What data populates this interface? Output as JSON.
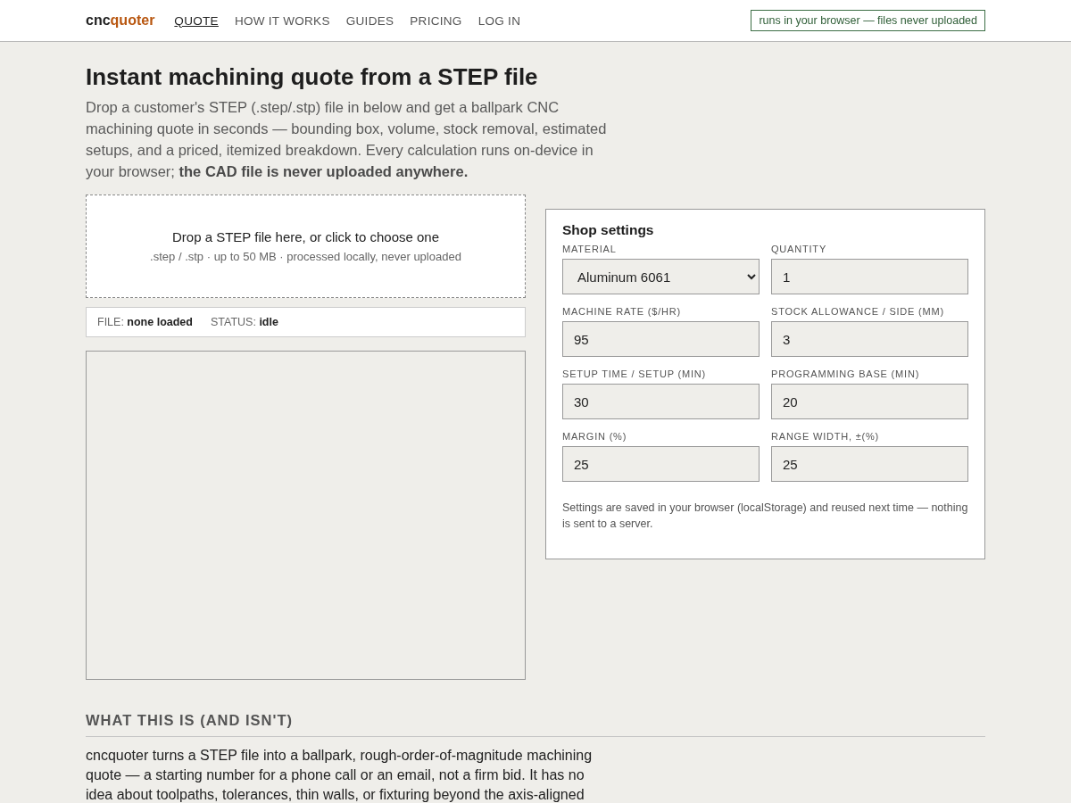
{
  "header": {
    "logo": {
      "prefix": "cnc",
      "accent": "quoter"
    },
    "nav": [
      {
        "label": "QUOTE",
        "selected": true
      },
      {
        "label": "HOW IT WORKS",
        "selected": false
      },
      {
        "label": "GUIDES",
        "selected": false
      },
      {
        "label": "PRICING",
        "selected": false
      },
      {
        "label": "LOG IN",
        "selected": false
      }
    ],
    "badge": "runs in your browser — files never uploaded"
  },
  "title": "Instant machining quote from a STEP file",
  "intro": "Drop a customer's STEP (.step/.stp) file in below and get a ballpark CNC machining quote in seconds — bounding box, volume, stock removal, estimated setups, and a priced, itemized breakdown. Every calculation runs on-device in your browser; **the CAD file is never uploaded anywhere.**",
  "dropzone": {
    "title": "Drop a STEP file here, or click to choose one",
    "hint": ".step / .stp · up to 50 MB · processed locally, never uploaded"
  },
  "status": [
    {
      "label": "FILE:",
      "value": "none loaded"
    },
    {
      "label": "STATUS:",
      "value": "idle"
    }
  ],
  "settings": {
    "title": "Shop settings",
    "fields": [
      {
        "kind": "select",
        "label": "MATERIAL",
        "value": "Aluminum 6061"
      },
      {
        "kind": "input",
        "label": "QUANTITY",
        "value": "1"
      },
      {
        "kind": "input",
        "label": "MACHINE RATE ($/HR)",
        "value": "95"
      },
      {
        "kind": "input",
        "label": "STOCK ALLOWANCE / SIDE (MM)",
        "value": "3"
      },
      {
        "kind": "input",
        "label": "SETUP TIME / SETUP (MIN)",
        "value": "30"
      },
      {
        "kind": "input",
        "label": "PROGRAMMING BASE (MIN)",
        "value": "20"
      },
      {
        "kind": "input",
        "label": "MARGIN (%)",
        "value": "25"
      },
      {
        "kind": "input",
        "label": "RANGE WIDTH, ±(%)",
        "value": "25"
      }
    ],
    "note": "Settings are saved in your browser (localStorage) and reused next time — nothing is sent to a server."
  },
  "about": {
    "heading": "WHAT THIS IS (AND ISN'T)",
    "text": "cncquoter turns a STEP file into a ballpark, rough-order-of-magnitude machining quote — a starting number for a phone call or an email, not a firm bid. It has no idea about toolpaths, tolerances, thin walls, or fixturing beyond the axis-aligned"
  }
}
